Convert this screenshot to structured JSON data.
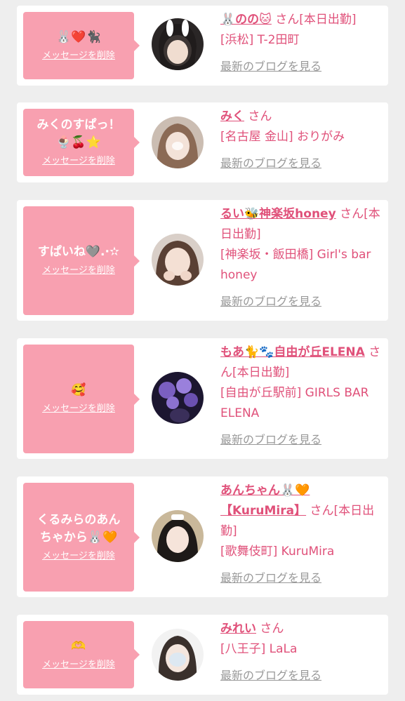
{
  "delete_label": "メッセージを削除",
  "blog_label": "最新のブログを見る",
  "san_label": "さん",
  "cards": [
    {
      "message": "🐰❤️🐈‍⬛",
      "name": "🐰のの🐱",
      "status": "[本日出勤]",
      "shop": "[浜松] T-2田町"
    },
    {
      "message": "みくのすぱっ！🍨🍒⭐️",
      "name": "みく",
      "status": "",
      "shop": "[名古屋 金山] おりがみ"
    },
    {
      "message": "すぱいね🩶.·✫",
      "name": "るい🐝神楽坂honey",
      "status": "[本日出勤]",
      "shop": "[神楽坂・飯田橋] Girl's bar honey"
    },
    {
      "message": "🥰",
      "name": "もあ🐈🐾自由が丘ELENA",
      "status": "[本日出勤]",
      "shop": "[自由が丘駅前] GIRLS BAR ELENA"
    },
    {
      "message": "くるみらのあんちゃから🐰🧡",
      "name": "あんちゃん🐰🧡【KuruMira】",
      "status": "[本日出勤]",
      "shop": "[歌舞伎町] KuruMira"
    },
    {
      "message": "🫶",
      "name": "みれい",
      "status": "",
      "shop": "[八王子] LaLa"
    }
  ],
  "colors": {
    "page_bg": "#eeeeee",
    "bubble_bg": "#f8a0b0",
    "accent_text": "#e0517a",
    "muted_link": "#999999"
  }
}
